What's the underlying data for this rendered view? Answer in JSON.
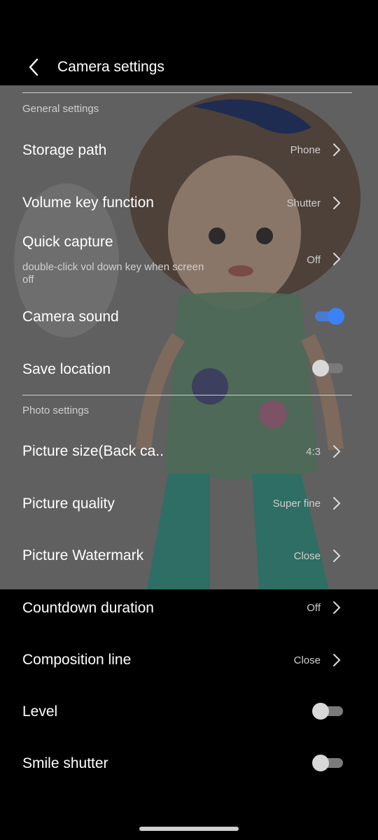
{
  "header": {
    "title": "Camera settings"
  },
  "general": {
    "section_label": "General settings",
    "storage_path": {
      "label": "Storage path",
      "value": "Phone"
    },
    "volume_key": {
      "label": "Volume key function",
      "value": "Shutter"
    },
    "quick_capture": {
      "label": "Quick capture",
      "sub": "double-click vol down key when screen off",
      "value": "Off"
    },
    "camera_sound": {
      "label": "Camera sound",
      "enabled": true
    },
    "save_location": {
      "label": "Save location",
      "enabled": false
    }
  },
  "photo": {
    "section_label": "Photo settings",
    "picture_size": {
      "label": "Picture size(Back ca..",
      "value": "4:3"
    },
    "picture_quality": {
      "label": "Picture quality",
      "value": "Super fine"
    },
    "picture_watermark": {
      "label": "Picture Watermark",
      "value": "Close"
    },
    "countdown": {
      "label": "Countdown duration",
      "value": "Off"
    },
    "composition_line": {
      "label": "Composition line",
      "value": "Close"
    },
    "level": {
      "label": "Level",
      "enabled": false
    },
    "smile_shutter": {
      "label": "Smile shutter",
      "enabled": false
    }
  },
  "colors": {
    "accent": "#3b82f6",
    "background": "#000000",
    "overlay": "#5e5e5e"
  }
}
